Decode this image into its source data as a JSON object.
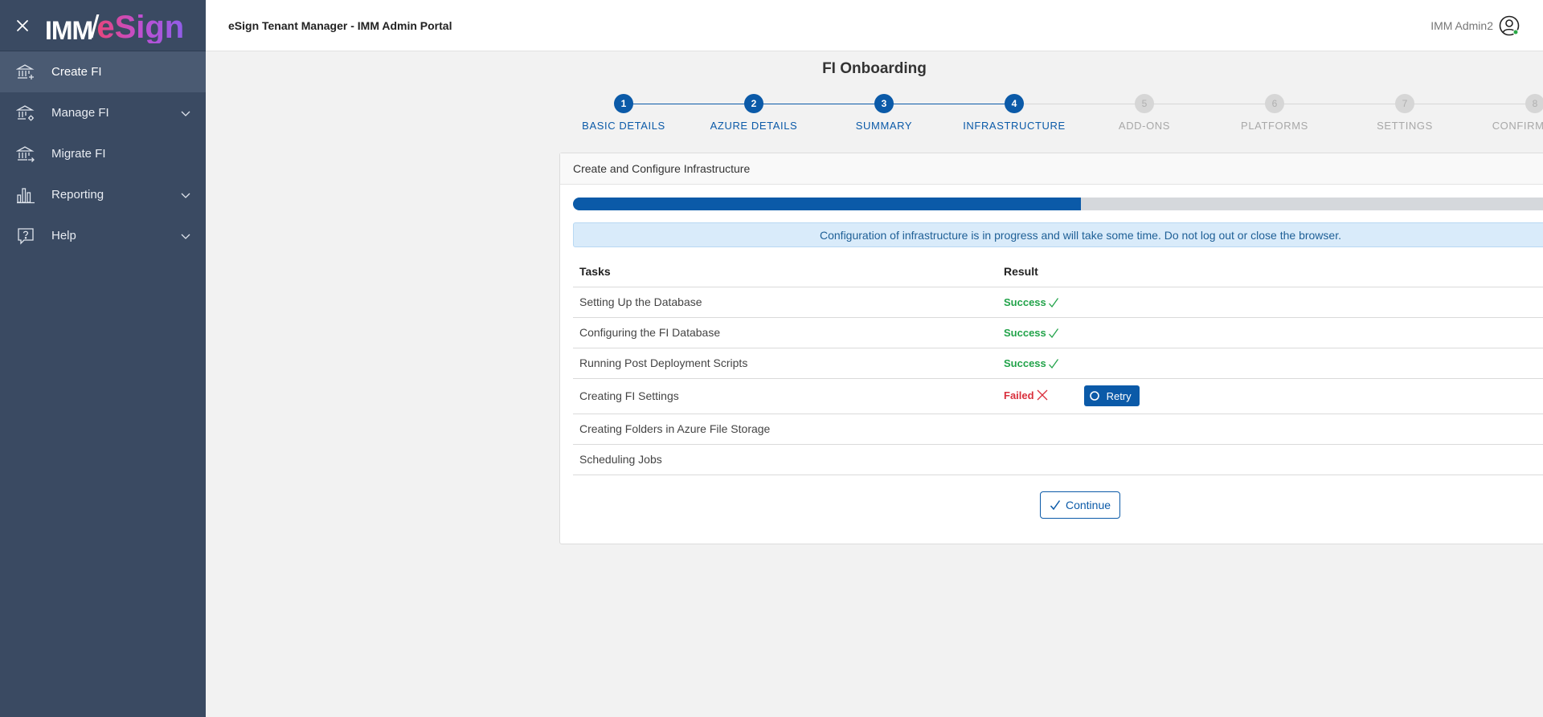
{
  "sidebar": {
    "logo_prefix": "IMM",
    "logo_slash": "/",
    "logo_brand": "eSign",
    "items": [
      {
        "label": "Create FI",
        "icon": "bank-add-icon",
        "active": true,
        "expandable": false
      },
      {
        "label": "Manage FI",
        "icon": "bank-settings-icon",
        "active": false,
        "expandable": true
      },
      {
        "label": "Migrate FI",
        "icon": "bank-migrate-icon",
        "active": false,
        "expandable": false
      },
      {
        "label": "Reporting",
        "icon": "bar-chart-icon",
        "active": false,
        "expandable": true
      },
      {
        "label": "Help",
        "icon": "help-icon",
        "active": false,
        "expandable": true
      }
    ]
  },
  "header": {
    "title": "eSign Tenant Manager - IMM Admin Portal",
    "user_name": "IMM Admin2"
  },
  "page": {
    "title": "FI Onboarding"
  },
  "stepper": {
    "steps": [
      {
        "number": "1",
        "label": "BASIC DETAILS",
        "status": "done"
      },
      {
        "number": "2",
        "label": "AZURE DETAILS",
        "status": "done"
      },
      {
        "number": "3",
        "label": "SUMMARY",
        "status": "done"
      },
      {
        "number": "4",
        "label": "INFRASTRUCTURE",
        "status": "done"
      },
      {
        "number": "5",
        "label": "ADD-ONS",
        "status": "pending"
      },
      {
        "number": "6",
        "label": "PLATFORMS",
        "status": "pending"
      },
      {
        "number": "7",
        "label": "SETTINGS",
        "status": "pending"
      },
      {
        "number": "8",
        "label": "CONFIRMATION",
        "status": "pending"
      }
    ]
  },
  "card": {
    "title": "Create and Configure Infrastructure",
    "progress_percent": 50,
    "alert": "Configuration of infrastructure is in progress and will take some time. Do not log out or close the browser.",
    "columns": {
      "task": "Tasks",
      "result": "Result"
    },
    "tasks": [
      {
        "name": "Setting Up the Database",
        "result": "Success"
      },
      {
        "name": "Configuring the FI Database",
        "result": "Success"
      },
      {
        "name": "Running Post Deployment Scripts",
        "result": "Success"
      },
      {
        "name": "Creating FI Settings",
        "result": "Failed"
      },
      {
        "name": "Creating Folders in Azure File Storage",
        "result": ""
      },
      {
        "name": "Scheduling Jobs",
        "result": ""
      }
    ],
    "retry_label": "Retry",
    "continue_label": "Continue"
  },
  "colors": {
    "sidebar_bg": "#3a4a62",
    "primary": "#0b5aa8",
    "success": "#22a34a",
    "failed": "#d9303d",
    "pending": "#d6d6d6"
  }
}
